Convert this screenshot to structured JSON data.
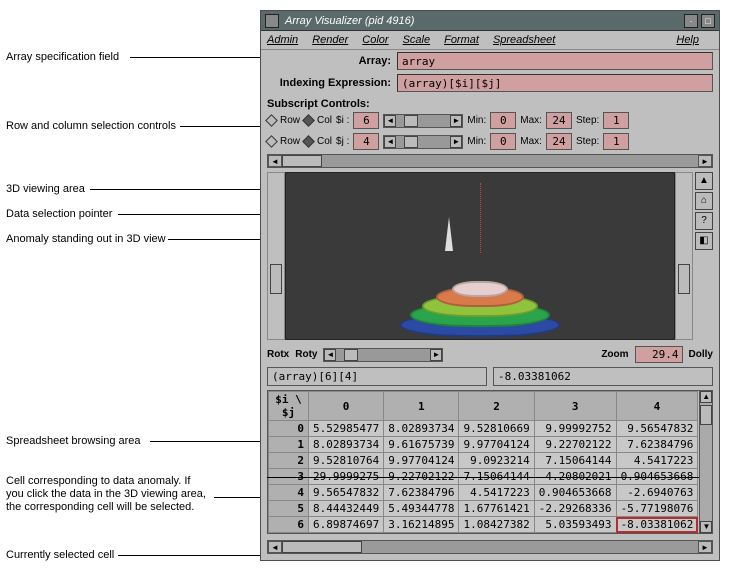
{
  "window": {
    "title": "Array Visualizer (pid 4916)"
  },
  "menubar": [
    "Admin",
    "Render",
    "Color",
    "Scale",
    "Format",
    "Spreadsheet"
  ],
  "menubar_right": "Help",
  "fields": {
    "array_label": "Array:",
    "array_value": "array",
    "index_label": "Indexing Expression:",
    "index_value": "(array)[$i][$j]",
    "subscript_label": "Subscript Controls:"
  },
  "subscripts": [
    {
      "row_label": "Row",
      "col_label": "Col",
      "var": "$i :",
      "val": "6",
      "min_label": "Min:",
      "min": "0",
      "max_label": "Max:",
      "max": "24",
      "step_label": "Step:",
      "step": "1"
    },
    {
      "row_label": "Row",
      "col_label": "Col",
      "var": "$j :",
      "val": "4",
      "min_label": "Min:",
      "min": "0",
      "max_label": "Max:",
      "max": "24",
      "step_label": "Step:",
      "step": "1"
    }
  ],
  "rot_row": {
    "rotx": "Rotx",
    "roty": "Roty",
    "zoom_label": "Zoom",
    "zoom_value": "29.4",
    "dolly": "Dolly"
  },
  "expr": {
    "left": "(array)[6][4]",
    "right": "-8.03381062"
  },
  "sheet": {
    "corner": "$i \\ $j",
    "cols": [
      "0",
      "1",
      "2",
      "3",
      "4"
    ],
    "rows": [
      {
        "hdr": "0",
        "cells": [
          "5.52985477",
          "8.02893734",
          "9.52810669",
          "9.99992752",
          "9.56547832"
        ]
      },
      {
        "hdr": "1",
        "cells": [
          "8.02893734",
          "9.61675739",
          "9.97704124",
          "9.22702122",
          "7.62384796"
        ]
      },
      {
        "hdr": "2",
        "cells": [
          "9.52810764",
          "9.97704124",
          "9.0923214",
          "7.15064144",
          "4.5417223"
        ]
      },
      {
        "hdr": "3",
        "cells": [
          "29.9999275",
          "9.22702122",
          "7.15064144",
          "4.20802021",
          "0.904653668"
        ]
      },
      {
        "hdr": "4",
        "cells": [
          "9.56547832",
          "7.62384796",
          "4.5417223",
          "0.904653668",
          "-2.6940763"
        ]
      },
      {
        "hdr": "5",
        "cells": [
          "8.44432449",
          "5.49344778",
          "1.67761421",
          "-2.29268336",
          "-5.77198076"
        ]
      },
      {
        "hdr": "6",
        "cells": [
          "6.89874697",
          "3.16214895",
          "1.08427382",
          "5.03593493",
          "-8.03381062"
        ]
      }
    ],
    "anomaly_row": 3,
    "selected": {
      "row": 6,
      "col": 4
    }
  },
  "annotations": {
    "array_spec": "Array specification field",
    "rowcol": "Row and column selection controls",
    "view3d": "3D viewing area",
    "pointer": "Data selection pointer",
    "anomaly3d": "Anomaly standing out in 3D view",
    "sheet": "Spreadsheet browsing area",
    "anomcell": "Cell corresponding to data anomaly. If\nyou click the data in the 3D viewing area,\nthe corresponding cell will be selected.",
    "selected": "Currently selected cell"
  }
}
